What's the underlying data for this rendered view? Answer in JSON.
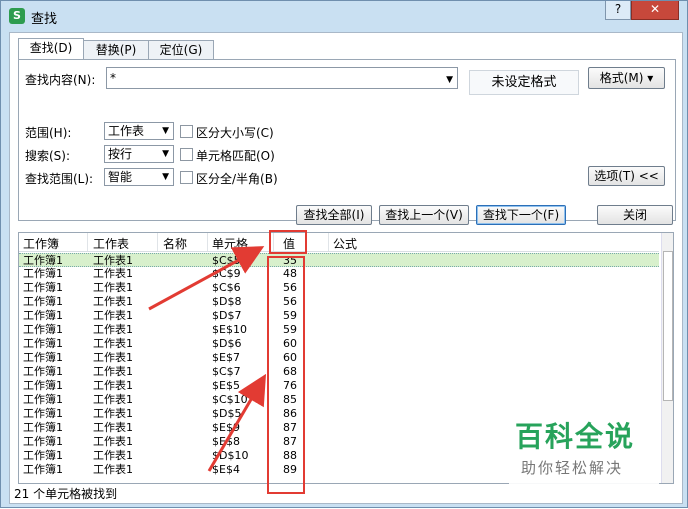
{
  "window": {
    "title": "查找",
    "help_label": "?",
    "close_label": "✕"
  },
  "tabs": [
    {
      "label": "查找(D)",
      "active": true
    },
    {
      "label": "替换(P)",
      "active": false
    },
    {
      "label": "定位(G)",
      "active": false
    }
  ],
  "find": {
    "content_label": "查找内容(N):",
    "content_value": "*",
    "format_status": "未设定格式",
    "format_button": "格式(M) ▾"
  },
  "options": {
    "scope_label": "范围(H):",
    "scope_value": "工作表",
    "search_label": "搜索(S):",
    "search_value": "按行",
    "lookin_label": "查找范围(L):",
    "lookin_value": "智能",
    "match_case": "区分大小写(C)",
    "match_cell": "单元格匹配(O)",
    "match_width": "区分全/半角(B)",
    "options_button": "选项(T) <<"
  },
  "actions": {
    "find_all": "查找全部(I)",
    "find_prev": "查找上一个(V)",
    "find_next": "查找下一个(F)",
    "close": "关闭"
  },
  "results": {
    "columns": [
      "工作簿",
      "工作表",
      "名称",
      "单元格",
      "值",
      "公式"
    ],
    "rows": [
      [
        "工作簿1",
        "工作表1",
        "",
        "$C$5",
        "35"
      ],
      [
        "工作簿1",
        "工作表1",
        "",
        "$C$9",
        "48"
      ],
      [
        "工作簿1",
        "工作表1",
        "",
        "$C$6",
        "56"
      ],
      [
        "工作簿1",
        "工作表1",
        "",
        "$D$8",
        "56"
      ],
      [
        "工作簿1",
        "工作表1",
        "",
        "$D$7",
        "59"
      ],
      [
        "工作簿1",
        "工作表1",
        "",
        "$E$10",
        "59"
      ],
      [
        "工作簿1",
        "工作表1",
        "",
        "$D$6",
        "60"
      ],
      [
        "工作簿1",
        "工作表1",
        "",
        "$E$7",
        "60"
      ],
      [
        "工作簿1",
        "工作表1",
        "",
        "$C$7",
        "68"
      ],
      [
        "工作簿1",
        "工作表1",
        "",
        "$E$5",
        "76"
      ],
      [
        "工作簿1",
        "工作表1",
        "",
        "$C$10",
        "85"
      ],
      [
        "工作簿1",
        "工作表1",
        "",
        "$D$5",
        "86"
      ],
      [
        "工作簿1",
        "工作表1",
        "",
        "$E$9",
        "87"
      ],
      [
        "工作簿1",
        "工作表1",
        "",
        "$E$8",
        "87"
      ],
      [
        "工作簿1",
        "工作表1",
        "",
        "$D$10",
        "88"
      ],
      [
        "工作簿1",
        "工作表1",
        "",
        "$E$4",
        "89"
      ]
    ],
    "status": "21 个单元格被找到"
  },
  "watermark": {
    "title": "百科全说",
    "subtitle": "助你轻松解决"
  },
  "colors": {
    "annotation": "#e23b33",
    "highlight_row": "#d8f0cc",
    "watermark_green": "#27a35b"
  }
}
